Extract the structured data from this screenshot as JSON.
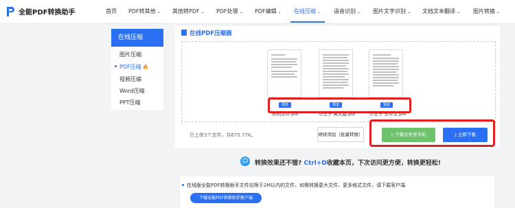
{
  "app": {
    "title": "全能PDF转换助手",
    "logo_icon": "pdf-logo-icon"
  },
  "nav": {
    "items": [
      {
        "label": "首页",
        "chevron": false,
        "active": false
      },
      {
        "label": "PDF转其他",
        "chevron": true,
        "active": false
      },
      {
        "label": "其他转PDF",
        "chevron": true,
        "active": false
      },
      {
        "label": "PDF处理",
        "chevron": true,
        "active": false
      },
      {
        "label": "PDF编辑",
        "chevron": true,
        "active": false
      },
      {
        "label": "在线压缩",
        "chevron": true,
        "active": true
      },
      {
        "label": "语音识别",
        "chevron": true,
        "active": false
      },
      {
        "label": "图片文字识别",
        "chevron": true,
        "active": false
      },
      {
        "label": "文档文本翻译",
        "chevron": true,
        "active": false
      },
      {
        "label": "图片转换",
        "chevron": true,
        "active": false
      }
    ]
  },
  "sidebar": {
    "header": "在线压缩",
    "items": [
      {
        "label": "图片压缩",
        "active": false
      },
      {
        "label": "PDF压缩",
        "active": true,
        "hot": true
      },
      {
        "label": "视频压缩",
        "active": false
      },
      {
        "label": "Word压缩",
        "active": false
      },
      {
        "label": "PPT压缩",
        "active": false
      }
    ]
  },
  "main": {
    "section_title": "在线PDF压缩器",
    "files": [
      {
        "name": "示例文件.pdf",
        "preview_label": "预览"
      },
      {
        "name": "小王子 英文版.pdf",
        "preview_label": "预览"
      },
      {
        "name": "小王子 长中文.pdf",
        "preview_label": "预览"
      }
    ],
    "upload_info": "已上传3个文件，共675.77K。",
    "add_button": "继续添加（批量转换）",
    "phone_button": "下载文件至手机",
    "download_button": "立即下载"
  },
  "promo": {
    "text_pre": "转换效果还不错?",
    "highlight": "Ctrl+D",
    "text_post": "收藏本页，下次访问更方便，转换更轻松!"
  },
  "notice": {
    "text": "在线版全能PDF转换助手文件仅限于2M以内的文件，如需转换更大文件、更多格式文件，请下载客户端",
    "client_button": "下载全能PDF转换助手客户端"
  },
  "colors": {
    "accent": "#2b6ff3",
    "green": "#6dc26b",
    "highlight_border": "#e02020"
  }
}
